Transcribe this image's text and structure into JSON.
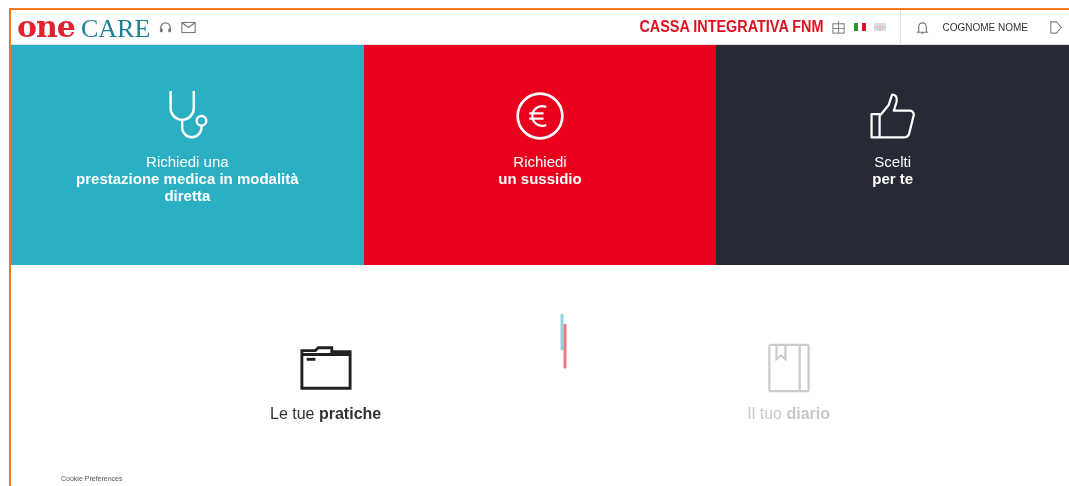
{
  "header": {
    "logo_one": "one",
    "logo_care": "CARE",
    "organization": "CASSA INTEGRATIVA FNM",
    "languages": [
      {
        "kind": "it",
        "selected": true
      },
      {
        "kind": "en",
        "selected": false
      }
    ],
    "user": "COGNOME NOME"
  },
  "tiles": [
    {
      "kind": "stethoscope",
      "color": "#2bb0c3",
      "line1": "Richiedi una",
      "line2": "prestazione medica in modalità diretta"
    },
    {
      "kind": "euro",
      "color": "#e8001c",
      "line1": "Richiedi",
      "line2": "un sussidio"
    },
    {
      "kind": "thumb",
      "color": "#272a35",
      "line1": "Scelti",
      "line2": "per te"
    }
  ],
  "sections": [
    {
      "kind": "folder",
      "label": "Le tue **pratiche**",
      "disabled": false
    },
    {
      "kind": "diary",
      "label": "Il tuo **diario**",
      "disabled": true
    }
  ],
  "footer": {
    "link": "Cookie Preferences"
  }
}
